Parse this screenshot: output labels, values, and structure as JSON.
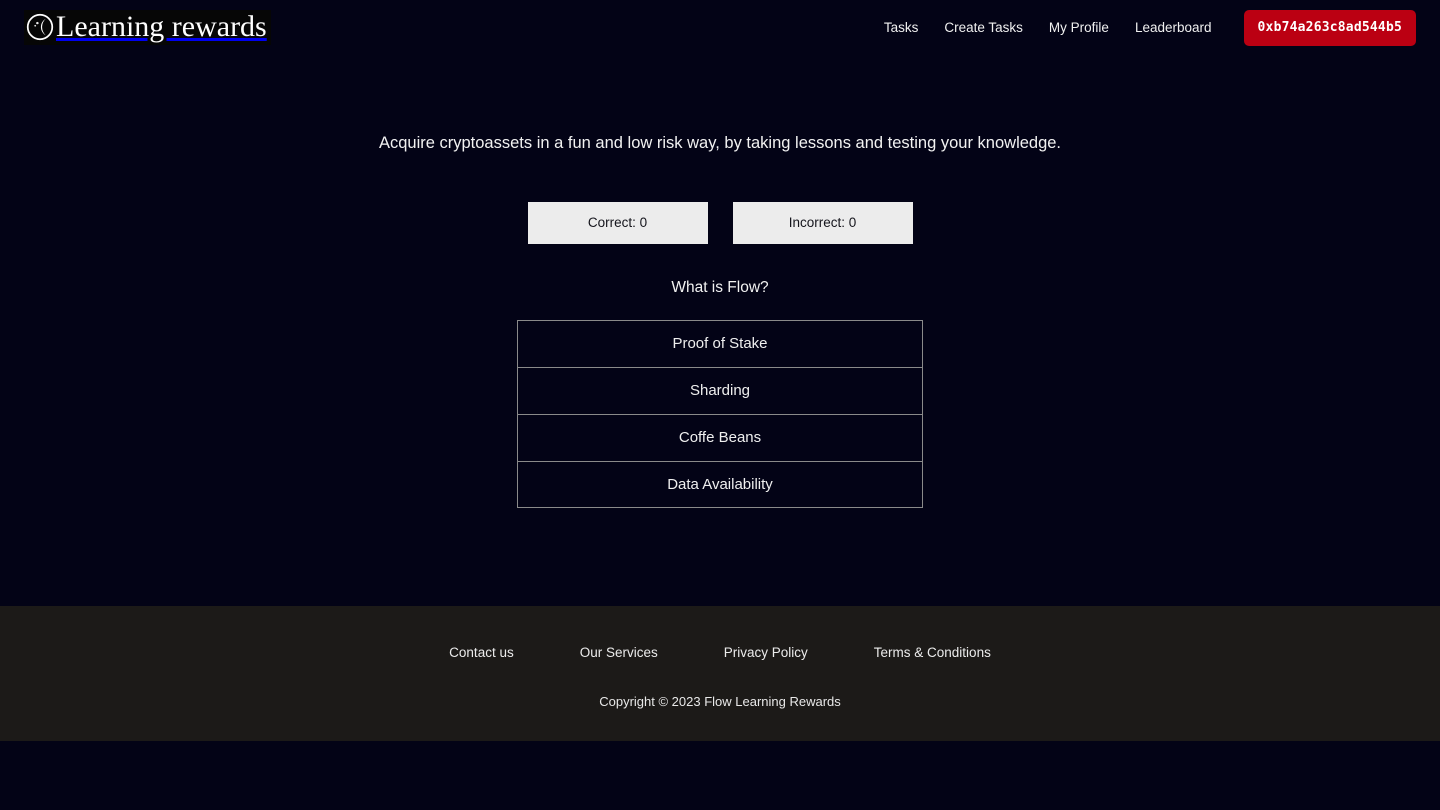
{
  "header": {
    "brand": {
      "logo_icon": "crescent-moon-circle-icon",
      "name": "Learning rewards"
    },
    "nav_links": [
      {
        "label": "Tasks"
      },
      {
        "label": "Create Tasks"
      },
      {
        "label": "My Profile"
      },
      {
        "label": "Leaderboard"
      }
    ],
    "wallet_button": {
      "label": "0xb74a263c8ad544b5",
      "color": "#bb0012"
    }
  },
  "main": {
    "tagline": "Acquire cryptoassets in a fun and low risk way, by taking lessons and testing your knowledge.",
    "scores": [
      {
        "label": "Correct: 0"
      },
      {
        "label": "Incorrect: 0"
      }
    ],
    "quiz": {
      "question": "What is Flow?",
      "options": [
        {
          "label": "Proof of Stake"
        },
        {
          "label": "Sharding"
        },
        {
          "label": "Coffe Beans"
        },
        {
          "label": "Data Availability"
        }
      ]
    }
  },
  "footer": {
    "links": [
      {
        "label": "Contact us"
      },
      {
        "label": "Our Services"
      },
      {
        "label": "Privacy Policy"
      },
      {
        "label": "Terms & Conditions"
      }
    ],
    "copyright": "Copyright © 2023 Flow Learning Rewards"
  },
  "colors": {
    "page_background": "#030316",
    "footer_background": "#1c1a18",
    "accent_red": "#bb0012",
    "score_box_background": "#ececec",
    "option_border": "#8a8a8a"
  }
}
